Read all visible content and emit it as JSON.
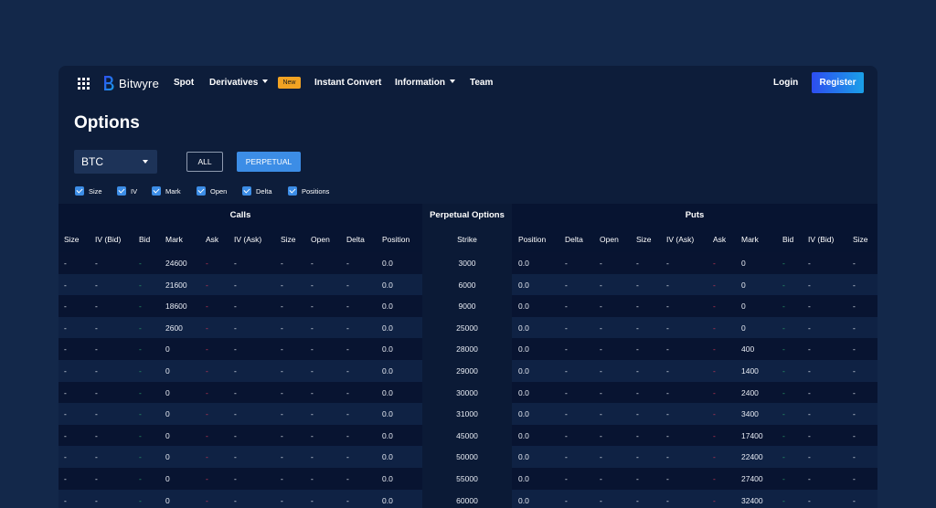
{
  "nav": {
    "logo_text": "Bitwyre",
    "links": [
      {
        "label": "Spot",
        "caret": false
      },
      {
        "label": "Derivatives",
        "caret": true
      },
      {
        "label": "Instant Convert",
        "caret": false
      },
      {
        "label": "Information",
        "caret": true
      },
      {
        "label": "Team",
        "caret": false
      }
    ],
    "new_badge": "New",
    "login": "Login",
    "register": "Register"
  },
  "page": {
    "title": "Options",
    "asset_select": "BTC",
    "filter_all": "ALL",
    "filter_perpetual": "PERPETUAL",
    "column_toggles": [
      "Size",
      "IV",
      "Mark",
      "Open",
      "Delta",
      "Positions"
    ]
  },
  "table": {
    "groups": {
      "calls": "Calls",
      "middle": "Perpetual Options",
      "puts": "Puts"
    },
    "call_headers": [
      "Size",
      "IV (Bid)",
      "Bid",
      "Mark",
      "Ask",
      "IV (Ask)",
      "Size",
      "Open",
      "Delta",
      "Position"
    ],
    "strike_header": "Strike",
    "put_headers": [
      "Position",
      "Delta",
      "Open",
      "Size",
      "IV (Ask)",
      "Ask",
      "Mark",
      "Bid",
      "IV (Bid)",
      "Size"
    ],
    "rows": [
      {
        "strike": "3000",
        "call_mark": "24600",
        "call_position": "0.0",
        "put_position": "0.0",
        "put_mark": "0"
      },
      {
        "strike": "6000",
        "call_mark": "21600",
        "call_position": "0.0",
        "put_position": "0.0",
        "put_mark": "0"
      },
      {
        "strike": "9000",
        "call_mark": "18600",
        "call_position": "0.0",
        "put_position": "0.0",
        "put_mark": "0"
      },
      {
        "strike": "25000",
        "call_mark": "2600",
        "call_position": "0.0",
        "put_position": "0.0",
        "put_mark": "0"
      },
      {
        "strike": "28000",
        "call_mark": "0",
        "call_position": "0.0",
        "put_position": "0.0",
        "put_mark": "400"
      },
      {
        "strike": "29000",
        "call_mark": "0",
        "call_position": "0.0",
        "put_position": "0.0",
        "put_mark": "1400"
      },
      {
        "strike": "30000",
        "call_mark": "0",
        "call_position": "0.0",
        "put_position": "0.0",
        "put_mark": "2400"
      },
      {
        "strike": "31000",
        "call_mark": "0",
        "call_position": "0.0",
        "put_position": "0.0",
        "put_mark": "3400"
      },
      {
        "strike": "45000",
        "call_mark": "0",
        "call_position": "0.0",
        "put_position": "0.0",
        "put_mark": "17400"
      },
      {
        "strike": "50000",
        "call_mark": "0",
        "call_position": "0.0",
        "put_position": "0.0",
        "put_mark": "22400"
      },
      {
        "strike": "55000",
        "call_mark": "0",
        "call_position": "0.0",
        "put_position": "0.0",
        "put_mark": "27400"
      },
      {
        "strike": "60000",
        "call_mark": "0",
        "call_position": "0.0",
        "put_position": "0.0",
        "put_mark": "32400"
      }
    ],
    "empty_value": "-"
  },
  "colors": {
    "page_bg": "#13284a",
    "panel_bg": "#0d1d3a",
    "accent": "#3c8de6",
    "badge": "#f2a323",
    "bid_green": "#2aa56a",
    "ask_red": "#d63a57"
  }
}
